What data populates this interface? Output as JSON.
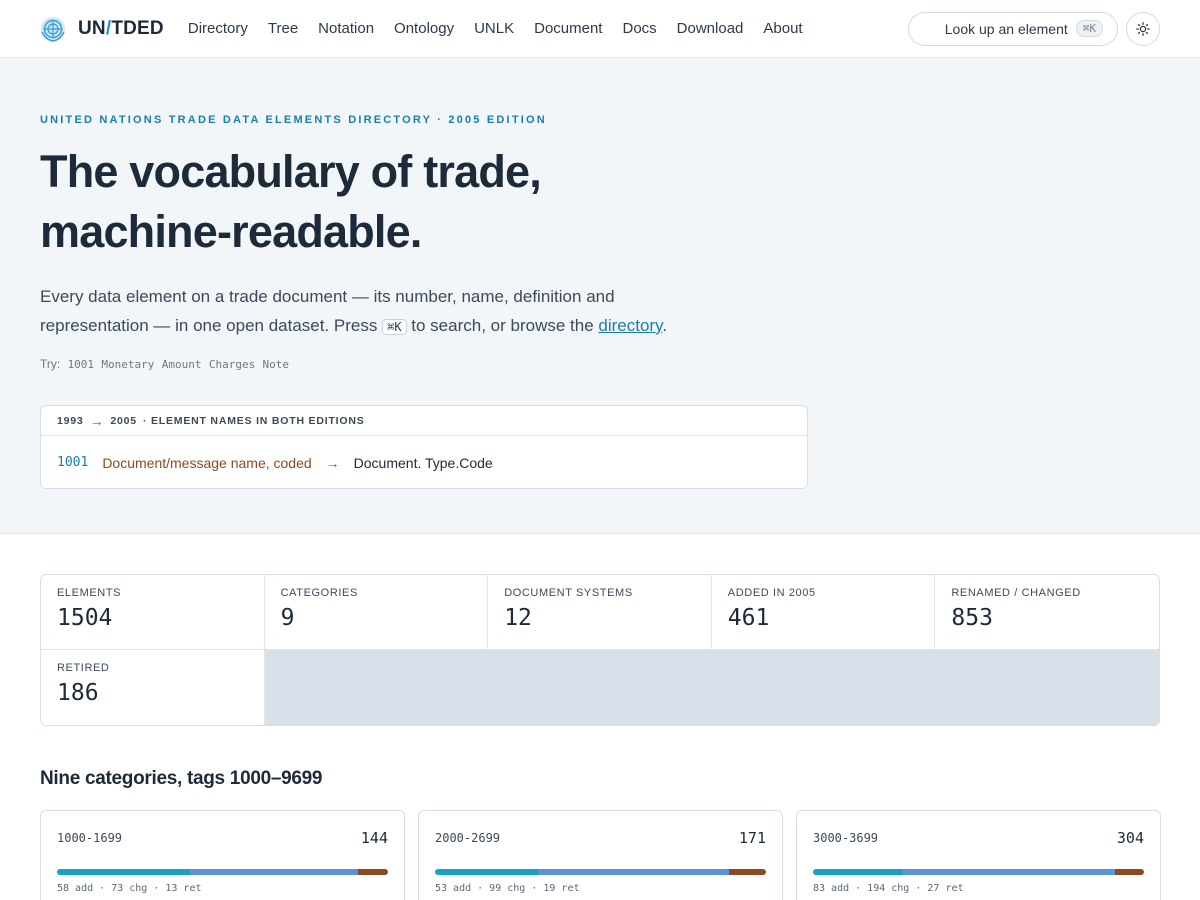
{
  "header": {
    "logo_text_a": "UN",
    "logo_slash": "/",
    "logo_text_b": "TDED",
    "nav": [
      "Directory",
      "Tree",
      "Notation",
      "Ontology",
      "UNLK",
      "Document",
      "Docs",
      "Download",
      "About"
    ],
    "search_label": "Look up an element",
    "search_shortcut": "⌘K",
    "theme_icon": "sun-icon"
  },
  "hero": {
    "eyebrow": "United Nations Trade Data Elements Directory · 2005 Edition",
    "title_line1": "The vocabulary of trade,",
    "title_line2": "machine-readable.",
    "lede_part1": "Every data element on a trade document — its number, name, definition and representation — in one open dataset. Press ",
    "lede_kbd": "⌘K",
    "lede_part2": " to search, or browse the ",
    "lede_link": "directory",
    "lede_end": ".",
    "try_label": "Try:",
    "try_chips": [
      "1001",
      "Monetary",
      "Amount",
      "Charges",
      "Note"
    ]
  },
  "crosswalk": {
    "from": "1993",
    "to": "2005",
    "heading": "· ELEMENT NAMES IN BOTH EDITIONS",
    "code": "1001",
    "old_name": "Document/message name, coded",
    "new_name": "Document. Type.Code"
  },
  "stats": [
    {
      "label": "Elements",
      "value": "1504"
    },
    {
      "label": "Categories",
      "value": "9"
    },
    {
      "label": "Document systems",
      "value": "12"
    },
    {
      "label": "Added in 2005",
      "value": "461"
    },
    {
      "label": "Renamed / Changed",
      "value": "853"
    },
    {
      "label": "Retired",
      "value": "186"
    }
  ],
  "categories_title": "Nine categories, tags 1000–9699",
  "categories": [
    {
      "range": "1000-1699",
      "total": "144",
      "add": 58,
      "chg": 73,
      "ret": 13,
      "legend": "58 add · 73 chg · 13 ret"
    },
    {
      "range": "2000-2699",
      "total": "171",
      "add": 53,
      "chg": 99,
      "ret": 19,
      "legend": "53 add · 99 chg · 19 ret"
    },
    {
      "range": "3000-3699",
      "total": "304",
      "add": 83,
      "chg": 194,
      "ret": 27,
      "legend": "83 add · 194 chg · 27 ret"
    }
  ],
  "colors": {
    "accent": "#1a7fa6",
    "added": "#1aa0c8",
    "changed": "#5b93d8",
    "retired": "#8a4a22"
  }
}
